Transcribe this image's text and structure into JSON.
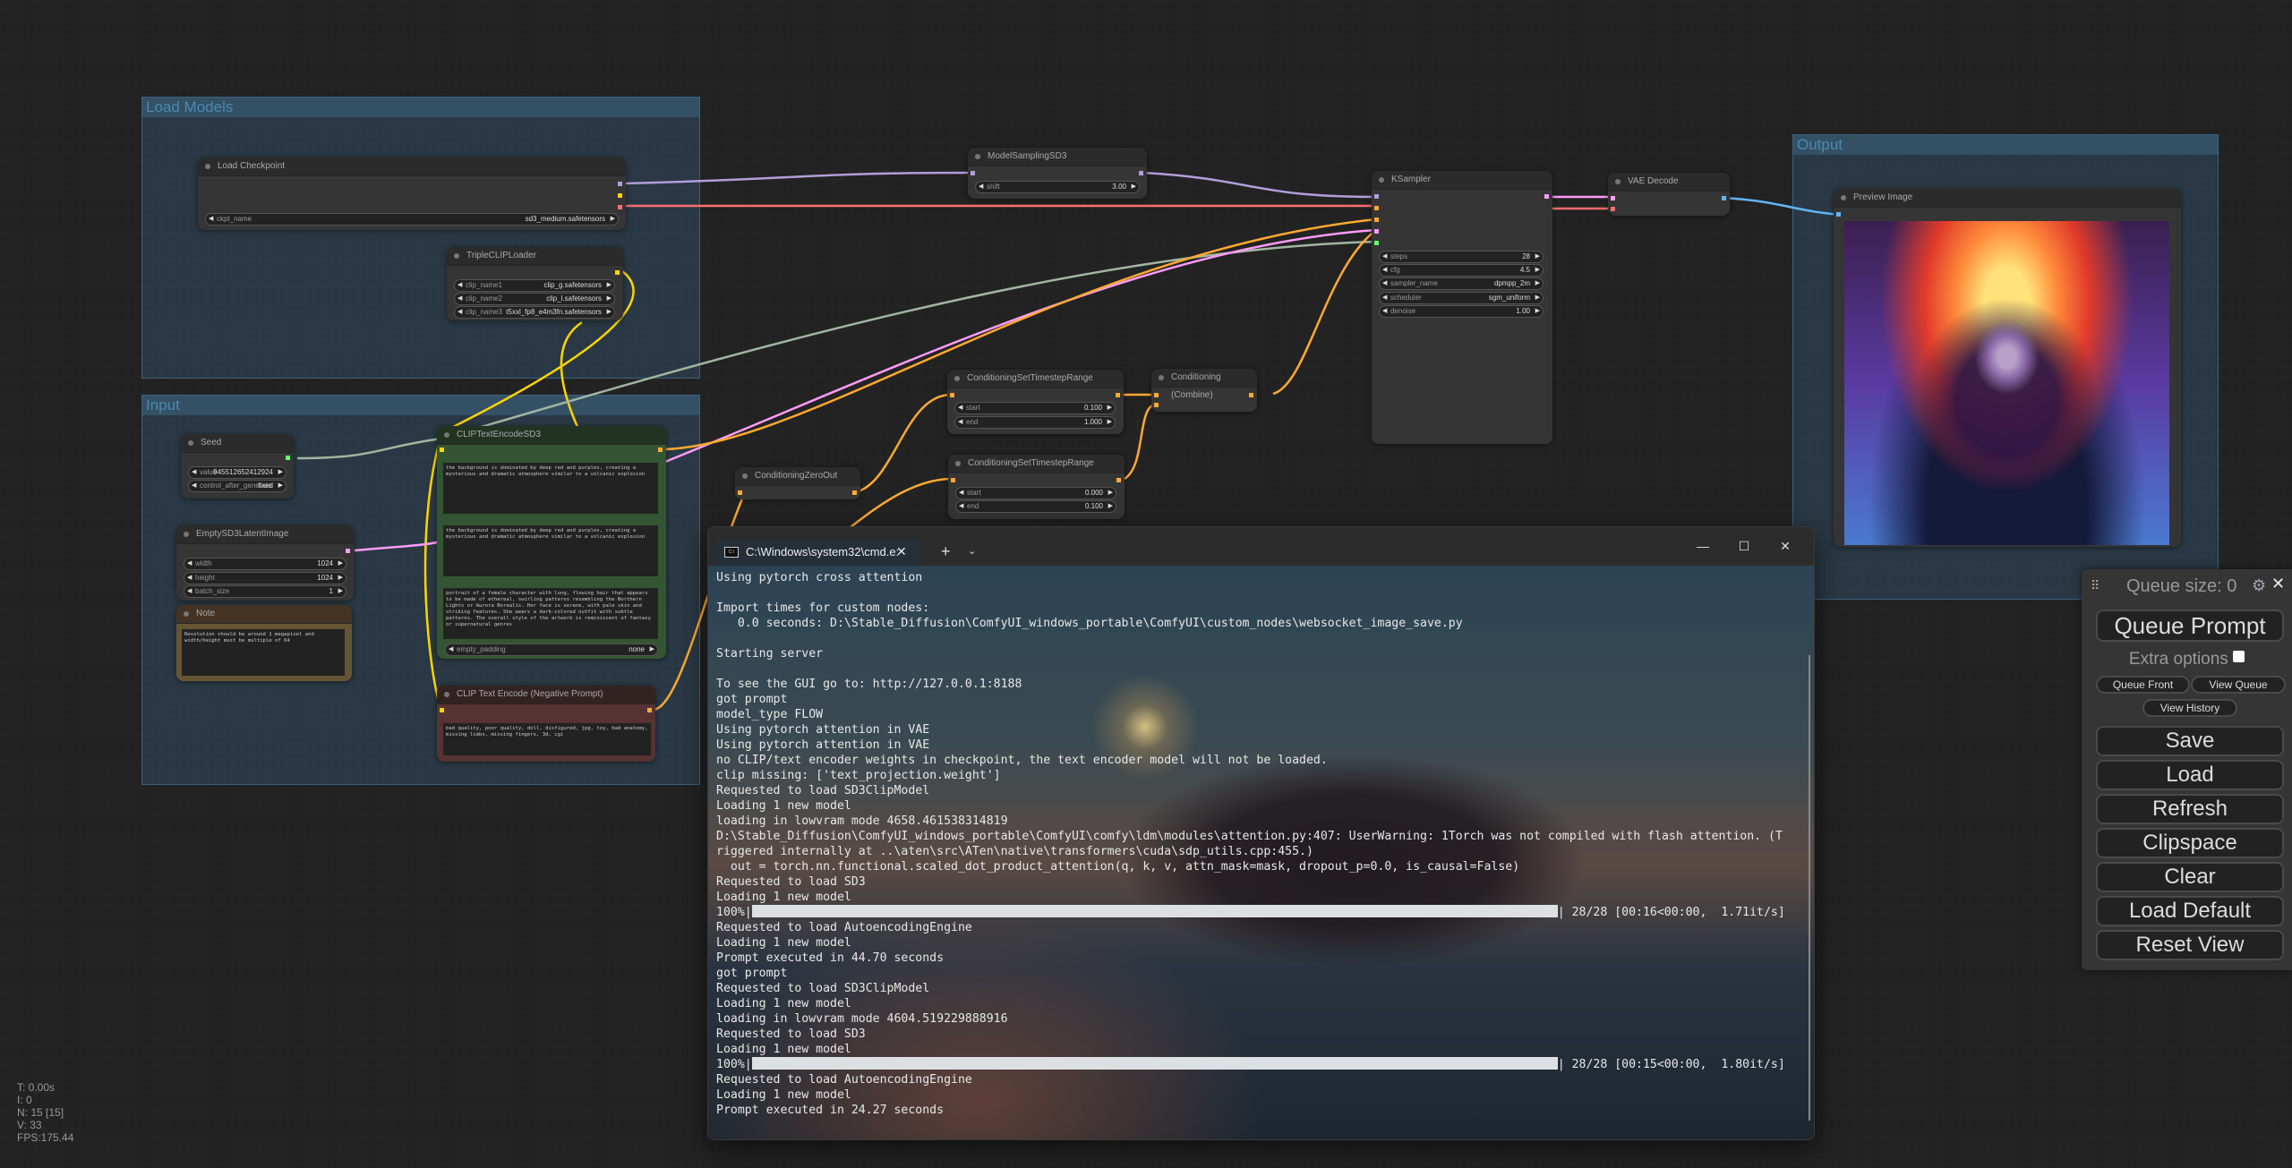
{
  "canvas": {
    "groups": [
      {
        "id": "load-models",
        "title": "Load Models"
      },
      {
        "id": "input",
        "title": "Input"
      },
      {
        "id": "output",
        "title": "Output"
      }
    ],
    "nodes": {
      "load_checkpoint": {
        "title": "Load Checkpoint",
        "widgets": [
          {
            "label": "ckpt_name",
            "value": "sd3_medium.safetensors"
          }
        ]
      },
      "triple_clip": {
        "title": "TripleCLIPLoader",
        "widgets": [
          {
            "label": "clip_name1",
            "value": "clip_g.safetensors"
          },
          {
            "label": "clip_name2",
            "value": "clip_l.safetensors"
          },
          {
            "label": "clip_name3",
            "value": "t5xxl_fp8_e4m3fn.safetensors"
          }
        ]
      },
      "seed": {
        "title": "Seed",
        "widgets": [
          {
            "label": "value",
            "value": "945512652412924"
          },
          {
            "label": "control_after_generate",
            "value": "fixed"
          }
        ]
      },
      "empty_latent": {
        "title": "EmptySD3LatentImage",
        "widgets": [
          {
            "label": "width",
            "value": "1024"
          },
          {
            "label": "height",
            "value": "1024"
          },
          {
            "label": "batch_size",
            "value": "1"
          }
        ]
      },
      "note": {
        "title": "Note",
        "text": "Resolution should be around 1 megapixel and width/height must be multiple of 64"
      },
      "clip_text_sd3": {
        "title": "CLIPTextEncodeSD3",
        "text_clip_l": "the background is dominated by deep red and purples, creating a mysterious and dramatic atmosphere similar to a volcanic explosion",
        "text_clip_g": "the background is dominated by deep red and purples, creating a mysterious and dramatic atmosphere similar to a volcanic explosion",
        "text_t5": "portrait of a female character with long, flowing hair that appears to be made of ethereal, swirling patterns resembling the Northern Lights or Aurora Borealis. Her face is serene, with pale skin and striking features. She wears a dark-colored outfit with subtle patterns. The overall style of the artwork is reminiscent of fantasy or supernatural genres",
        "widgets": [
          {
            "label": "empty_padding",
            "value": "none"
          }
        ]
      },
      "clip_negative": {
        "title": "CLIP Text Encode (Negative Prompt)",
        "text": "bad quality, poor quality, doll, disfigured, jpg, toy, bad anatomy, missing limbs, missing fingers, 3d, cgi"
      },
      "zero_out": {
        "title": "ConditioningZeroOut"
      },
      "timestep1": {
        "title": "ConditioningSetTimestepRange",
        "widgets": [
          {
            "label": "start",
            "value": "0.100"
          },
          {
            "label": "end",
            "value": "1.000"
          }
        ]
      },
      "timestep2": {
        "title": "ConditioningSetTimestepRange",
        "widgets": [
          {
            "label": "start",
            "value": "0.000"
          },
          {
            "label": "end",
            "value": "0.100"
          }
        ]
      },
      "combine": {
        "title": "Conditioning (Combine)"
      },
      "model_sampling": {
        "title": "ModelSamplingSD3",
        "widgets": [
          {
            "label": "shift",
            "value": "3.00"
          }
        ]
      },
      "ksampler": {
        "title": "KSampler",
        "widgets": [
          {
            "label": "steps",
            "value": "28"
          },
          {
            "label": "cfg",
            "value": "4.5"
          },
          {
            "label": "sampler_name",
            "value": "dpmpp_2m"
          },
          {
            "label": "scheduler",
            "value": "sgm_uniform"
          },
          {
            "label": "denoise",
            "value": "1.00"
          }
        ]
      },
      "vae_decode": {
        "title": "VAE Decode"
      },
      "preview": {
        "title": "Preview Image"
      }
    },
    "link_colors": {
      "model": "#b39ddb",
      "clip": "#ffd500",
      "vae": "#ff6e6e",
      "conditioning": "#ffa931",
      "latent": "#ff9cf9",
      "int": "#a1b6a0",
      "image": "#64b5f6"
    },
    "stats": {
      "t": "T: 0.00s",
      "i": "I: 0",
      "n": "N: 15 [15]",
      "v": "V: 33",
      "fps": "FPS:175.44"
    }
  },
  "terminal": {
    "tab_title": "C:\\Windows\\system32\\cmd.e:",
    "lines": [
      "Using pytorch cross attention",
      "",
      "Import times for custom nodes:",
      "   0.0 seconds: D:\\Stable_Diffusion\\ComfyUI_windows_portable\\ComfyUI\\custom_nodes\\websocket_image_save.py",
      "",
      "Starting server",
      "",
      "To see the GUI go to: http://127.0.0.1:8188",
      "got prompt",
      "model_type FLOW",
      "Using pytorch attention in VAE",
      "Using pytorch attention in VAE",
      "no CLIP/text encoder weights in checkpoint, the text encoder model will not be loaded.",
      "clip missing: ['text_projection.weight']",
      "Requested to load SD3ClipModel",
      "Loading 1 new model",
      "loading in lowvram mode 4658.461538314819",
      "D:\\Stable_Diffusion\\ComfyUI_windows_portable\\ComfyUI\\comfy\\ldm\\modules\\attention.py:407: UserWarning: 1Torch was not compiled with flash attention. (T",
      "riggered internally at ..\\aten\\src\\ATen\\native\\transformers\\cuda\\sdp_utils.cpp:455.)",
      "  out = torch.nn.functional.scaled_dot_product_attention(q, k, v, attn_mask=mask, dropout_p=0.0, is_causal=False)",
      "Requested to load SD3",
      "Loading 1 new model"
    ],
    "progress1": {
      "prefix": "100%|",
      "suffix": "| 28/28 [00:16<00:00,  1.71it/s]",
      "fraction": 1.0
    },
    "lines2": [
      "Requested to load AutoencodingEngine",
      "Loading 1 new model",
      "Prompt executed in 44.70 seconds",
      "got prompt",
      "Requested to load SD3ClipModel",
      "Loading 1 new model",
      "loading in lowvram mode 4604.519229888916",
      "Requested to load SD3",
      "Loading 1 new model"
    ],
    "progress2": {
      "prefix": "100%|",
      "suffix": "| 28/28 [00:15<00:00,  1.80it/s]",
      "fraction": 1.0
    },
    "lines3": [
      "Requested to load AutoencodingEngine",
      "Loading 1 new model",
      "Prompt executed in 24.27 seconds"
    ]
  },
  "queue_panel": {
    "queue_size": "Queue size: 0",
    "queue_prompt": "Queue Prompt",
    "extra_options": "Extra options",
    "queue_front": "Queue Front",
    "view_queue": "View Queue",
    "view_history": "View History",
    "buttons": [
      "Save",
      "Load",
      "Refresh",
      "Clipspace",
      "Clear",
      "Load Default",
      "Reset View"
    ]
  }
}
